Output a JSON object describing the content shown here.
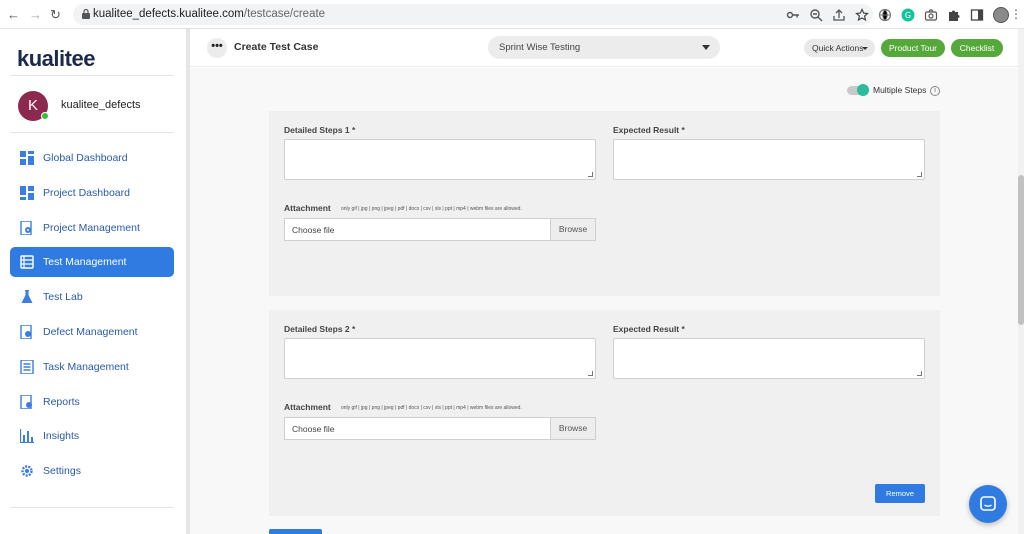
{
  "browser": {
    "url_host": "kualitee_defects.kualitee.com",
    "url_path": "/testcase/create"
  },
  "sidebar": {
    "logo": "kualitee",
    "user": {
      "initial": "K",
      "name": "kualitee_defects"
    },
    "items": [
      {
        "label": "Global Dashboard",
        "active": false
      },
      {
        "label": "Project Dashboard",
        "active": false
      },
      {
        "label": "Project Management",
        "active": false
      },
      {
        "label": "Test Management",
        "active": true
      },
      {
        "label": "Test Lab",
        "active": false
      },
      {
        "label": "Defect Management",
        "active": false
      },
      {
        "label": "Task Management",
        "active": false
      },
      {
        "label": "Reports",
        "active": false
      },
      {
        "label": "Insights",
        "active": false
      },
      {
        "label": "Settings",
        "active": false
      }
    ]
  },
  "topbar": {
    "title": "Create Test Case",
    "sprint_select": "Sprint Wise Testing",
    "quick_actions": "Quick Actions",
    "product_tour": "Product Tour",
    "checklist": "Checklist"
  },
  "content": {
    "multiple_steps_label": "Multiple Steps",
    "multiple_steps_enabled": true,
    "steps": [
      {
        "steps_label": "Detailed Steps 1 *",
        "expected_label": "Expected Result *",
        "attachment_label": "Attachment",
        "attachment_note": "only gif | jpg | png | jpeg | pdf | docx | csv | xls | ppt | mp4 | webm files are allowed.",
        "file_placeholder": "Choose file",
        "browse_label": "Browse"
      },
      {
        "steps_label": "Detailed Steps 2 *",
        "expected_label": "Expected Result *",
        "attachment_label": "Attachment",
        "attachment_note": "only gif | jpg | png | jpeg | pdf | docx | csv | xls | ppt | mp4 | webm files are allowed.",
        "file_placeholder": "Choose file",
        "browse_label": "Browse",
        "remove_label": "Remove"
      }
    ]
  },
  "colors": {
    "accent_blue": "#2f7be2",
    "accent_green": "#57a83b",
    "toggle_teal": "#2dbb9a",
    "avatar": "#8b2a4e"
  }
}
